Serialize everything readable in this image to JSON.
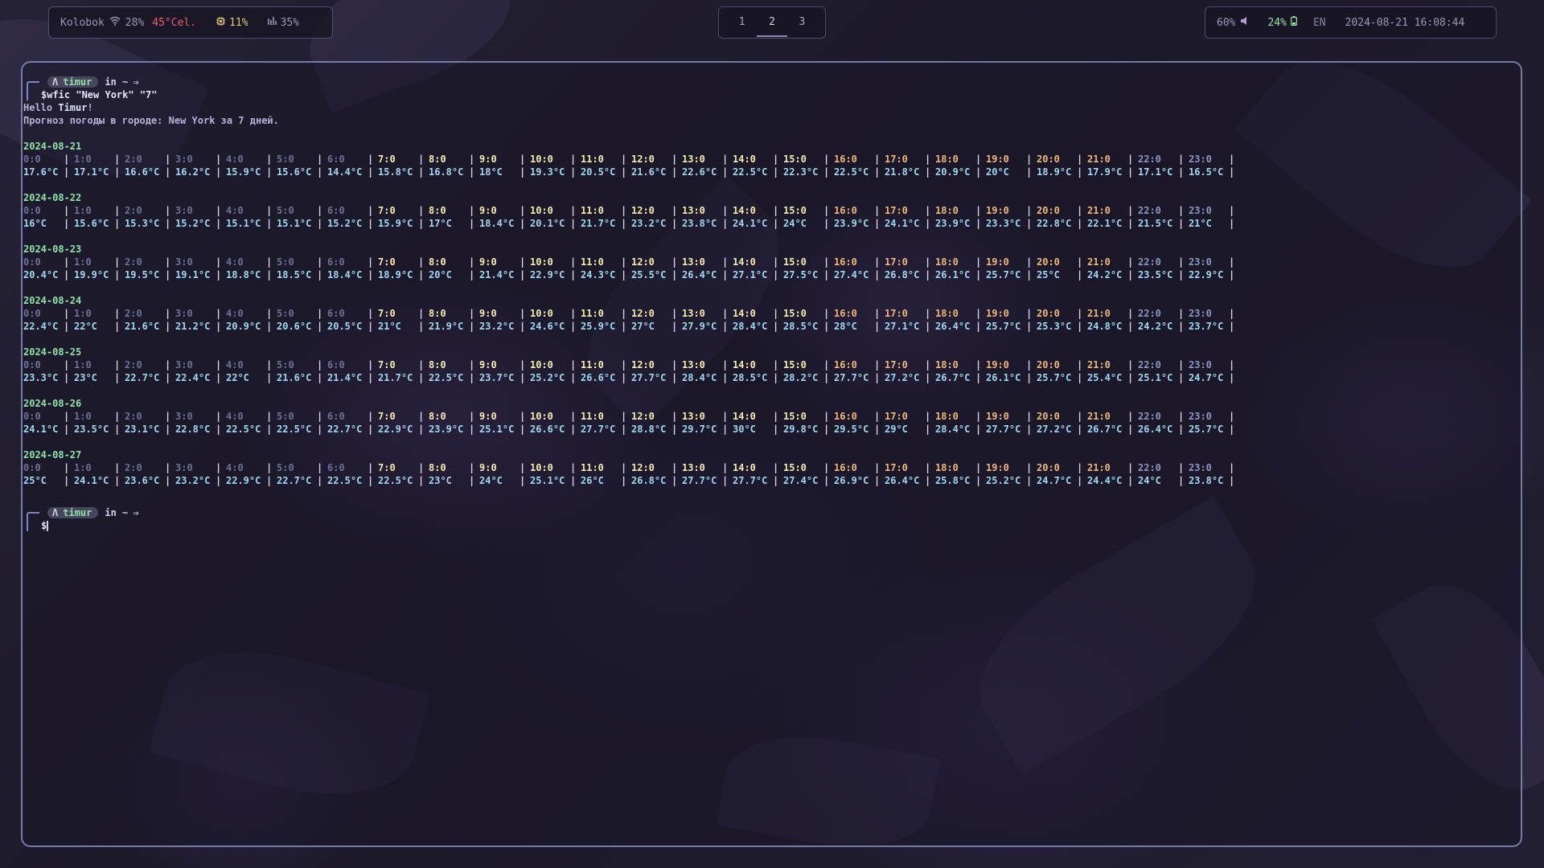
{
  "topbar": {
    "left": {
      "network_name": "Kolobok",
      "wifi_icon": "wifi-icon",
      "wifi_strength": "28%",
      "temperature": "45°Cel.",
      "cpu_icon": "cpu-icon",
      "cpu": "11%",
      "memory_icon": "memory-icon",
      "memory": "35%"
    },
    "workspaces": [
      {
        "label": "1",
        "active": false
      },
      {
        "label": "2",
        "active": true
      },
      {
        "label": "3",
        "active": false
      }
    ],
    "right": {
      "volume": "60%",
      "volume_icon": "speaker-icon",
      "battery": "24%",
      "battery_icon": "battery-icon",
      "layout": "EN",
      "datetime": "2024-08-21 16:08:44"
    }
  },
  "terminal": {
    "prompt": {
      "symbol": "Λ",
      "user": "timur",
      "in_text": "in ~",
      "arrow": "⇒"
    },
    "command": "$wfic \"New York\" \"7\"",
    "hello_prefix": "Hello ",
    "hello_name": "Timur",
    "hello_suffix": "!",
    "forecast_line": "Прогноз погоды в городе: New York за 7 дней.",
    "hours": [
      "0:0",
      "1:0",
      "2:0",
      "3:0",
      "4:0",
      "5:0",
      "6:0",
      "7:0",
      "8:0",
      "9:0",
      "10:0",
      "11:0",
      "12:0",
      "13:0",
      "14:0",
      "15:0",
      "16:0",
      "17:0",
      "18:0",
      "19:0",
      "20:0",
      "21:0",
      "22:0",
      "23:0"
    ],
    "days": [
      {
        "date": "2024-08-21",
        "temps": [
          "17.6°C",
          "17.1°C",
          "16.6°C",
          "16.2°C",
          "15.9°C",
          "15.6°C",
          "14.4°C",
          "15.8°C",
          "16.8°C",
          "18°C",
          "19.3°C",
          "20.5°C",
          "21.6°C",
          "22.6°C",
          "22.5°C",
          "22.3°C",
          "22.5°C",
          "21.8°C",
          "20.9°C",
          "20°C",
          "18.9°C",
          "17.9°C",
          "17.1°C",
          "16.5°C"
        ]
      },
      {
        "date": "2024-08-22",
        "temps": [
          "16°C",
          "15.6°C",
          "15.3°C",
          "15.2°C",
          "15.1°C",
          "15.1°C",
          "15.2°C",
          "15.9°C",
          "17°C",
          "18.4°C",
          "20.1°C",
          "21.7°C",
          "23.2°C",
          "23.8°C",
          "24.1°C",
          "24°C",
          "23.9°C",
          "24.1°C",
          "23.9°C",
          "23.3°C",
          "22.8°C",
          "22.1°C",
          "21.5°C",
          "21°C"
        ]
      },
      {
        "date": "2024-08-23",
        "temps": [
          "20.4°C",
          "19.9°C",
          "19.5°C",
          "19.1°C",
          "18.8°C",
          "18.5°C",
          "18.4°C",
          "18.9°C",
          "20°C",
          "21.4°C",
          "22.9°C",
          "24.3°C",
          "25.5°C",
          "26.4°C",
          "27.1°C",
          "27.5°C",
          "27.4°C",
          "26.8°C",
          "26.1°C",
          "25.7°C",
          "25°C",
          "24.2°C",
          "23.5°C",
          "22.9°C"
        ]
      },
      {
        "date": "2024-08-24",
        "temps": [
          "22.4°C",
          "22°C",
          "21.6°C",
          "21.2°C",
          "20.9°C",
          "20.6°C",
          "20.5°C",
          "21°C",
          "21.9°C",
          "23.2°C",
          "24.6°C",
          "25.9°C",
          "27°C",
          "27.9°C",
          "28.4°C",
          "28.5°C",
          "28°C",
          "27.1°C",
          "26.4°C",
          "25.7°C",
          "25.3°C",
          "24.8°C",
          "24.2°C",
          "23.7°C"
        ]
      },
      {
        "date": "2024-08-25",
        "temps": [
          "23.3°C",
          "23°C",
          "22.7°C",
          "22.4°C",
          "22°C",
          "21.6°C",
          "21.4°C",
          "21.7°C",
          "22.5°C",
          "23.7°C",
          "25.2°C",
          "26.6°C",
          "27.7°C",
          "28.4°C",
          "28.5°C",
          "28.2°C",
          "27.7°C",
          "27.2°C",
          "26.7°C",
          "26.1°C",
          "25.7°C",
          "25.4°C",
          "25.1°C",
          "24.7°C"
        ]
      },
      {
        "date": "2024-08-26",
        "temps": [
          "24.1°C",
          "23.5°C",
          "23.1°C",
          "22.8°C",
          "22.5°C",
          "22.5°C",
          "22.7°C",
          "22.9°C",
          "23.9°C",
          "25.1°C",
          "26.6°C",
          "27.7°C",
          "28.8°C",
          "29.7°C",
          "30°C",
          "29.8°C",
          "29.5°C",
          "29°C",
          "28.4°C",
          "27.7°C",
          "27.2°C",
          "26.7°C",
          "26.4°C",
          "25.7°C"
        ]
      },
      {
        "date": "2024-08-27",
        "temps": [
          "25°C",
          "24.1°C",
          "23.6°C",
          "23.2°C",
          "22.9°C",
          "22.7°C",
          "22.5°C",
          "22.5°C",
          "23°C",
          "24°C",
          "25.1°C",
          "26°C",
          "26.8°C",
          "27.7°C",
          "27.7°C",
          "27.4°C",
          "26.9°C",
          "26.4°C",
          "25.8°C",
          "25.2°C",
          "24.7°C",
          "24.4°C",
          "24°C",
          "23.8°C"
        ]
      }
    ]
  }
}
